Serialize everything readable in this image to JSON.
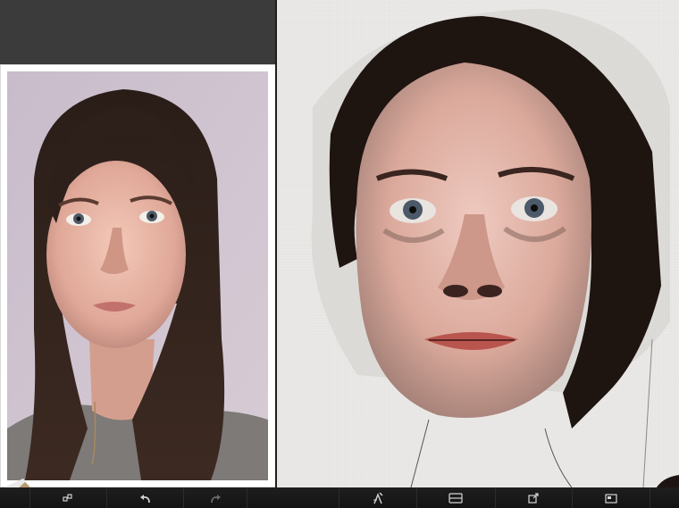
{
  "toolbar": {
    "buttons": [
      {
        "name": "swap-icon"
      },
      {
        "name": "undo-icon"
      },
      {
        "name": "redo-icon"
      },
      {
        "name": "brush-settings-icon"
      },
      {
        "name": "layers-icon"
      },
      {
        "name": "share-icon"
      },
      {
        "name": "gallery-icon"
      }
    ]
  },
  "colors": {
    "toolbar_bg": "#161616",
    "canvas_bg": "#ebe9e7",
    "current_color": "#1d1411",
    "reference_frame": "#ffffff"
  },
  "current_tool": "brush-tool-icon",
  "reference_image": "portrait-reference-photo",
  "canvas_image": "painted-portrait"
}
